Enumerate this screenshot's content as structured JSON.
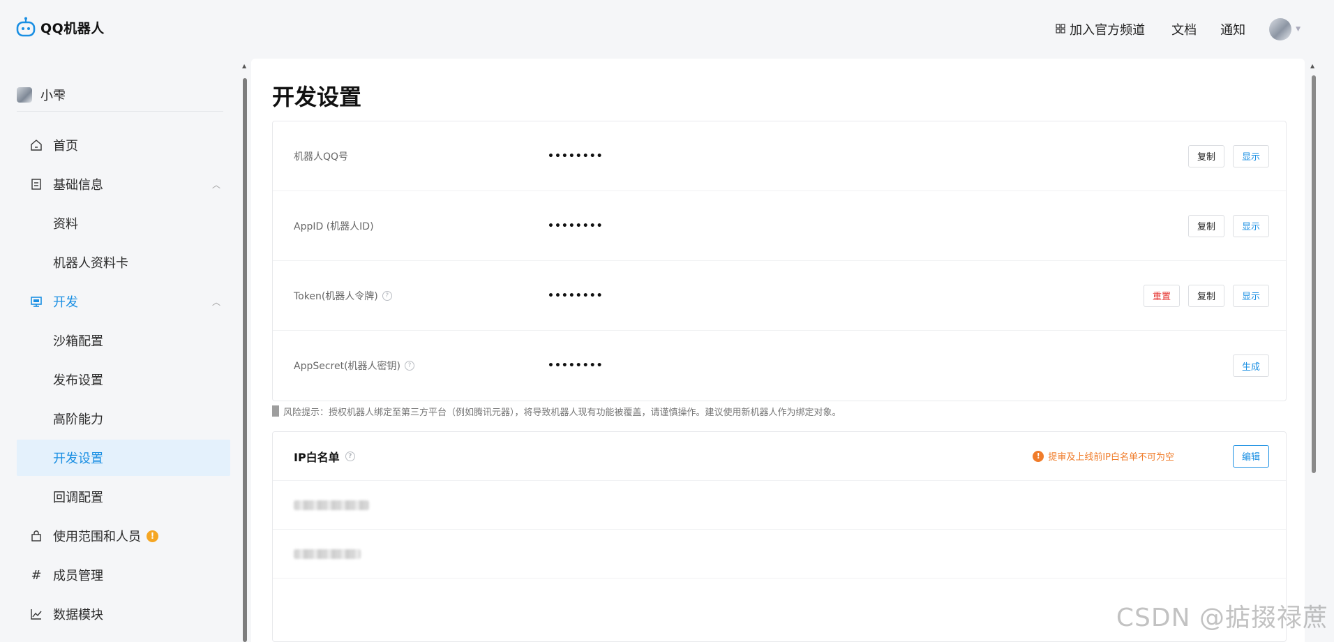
{
  "header": {
    "brand": "QQ机器人",
    "links": {
      "channel": "加入官方频道",
      "docs": "文档",
      "notify": "通知"
    }
  },
  "sidebar": {
    "user_name": "小雫",
    "items": [
      {
        "label": "首页",
        "icon": "home-icon"
      },
      {
        "label": "基础信息",
        "icon": "document-icon"
      },
      {
        "label": "资料"
      },
      {
        "label": "机器人资料卡"
      },
      {
        "label": "开发",
        "icon": "monitor-icon"
      },
      {
        "label": "沙箱配置"
      },
      {
        "label": "发布设置"
      },
      {
        "label": "高阶能力"
      },
      {
        "label": "开发设置"
      },
      {
        "label": "回调配置"
      },
      {
        "label": "使用范围和人员",
        "icon": "bag-icon",
        "badge": "!"
      },
      {
        "label": "成员管理",
        "icon": "hash-icon"
      },
      {
        "label": "数据模块",
        "icon": "chart-icon"
      }
    ]
  },
  "main": {
    "title": "开发设置",
    "credentials": [
      {
        "label": "机器人QQ号",
        "value": "••••••••",
        "buttons": [
          "复制",
          "显示"
        ]
      },
      {
        "label": "AppID (机器人ID)",
        "value": "••••••••",
        "buttons": [
          "复制",
          "显示"
        ]
      },
      {
        "label": "Token(机器人令牌)",
        "value": "••••••••",
        "buttons": [
          "重置",
          "复制",
          "显示"
        ]
      },
      {
        "label": "AppSecret(机器人密钥)",
        "value": "••••••••",
        "buttons": [
          "生成"
        ]
      }
    ],
    "risk_note": "风险提示：授权机器人绑定至第三方平台（例如腾讯元器），将导致机器人现有功能被覆盖，请谨慎操作。建议使用新机器人作为绑定对象。",
    "ip_whitelist": {
      "title": "IP白名单",
      "warning": "提审及上线前IP白名单不可为空",
      "edit_label": "编辑"
    }
  },
  "watermark": "CSDN @掂掇禄蔗",
  "colors": {
    "accent": "#1a8fe3",
    "danger": "#e53935",
    "warning": "#f07c2a",
    "badge": "#f5a623"
  }
}
